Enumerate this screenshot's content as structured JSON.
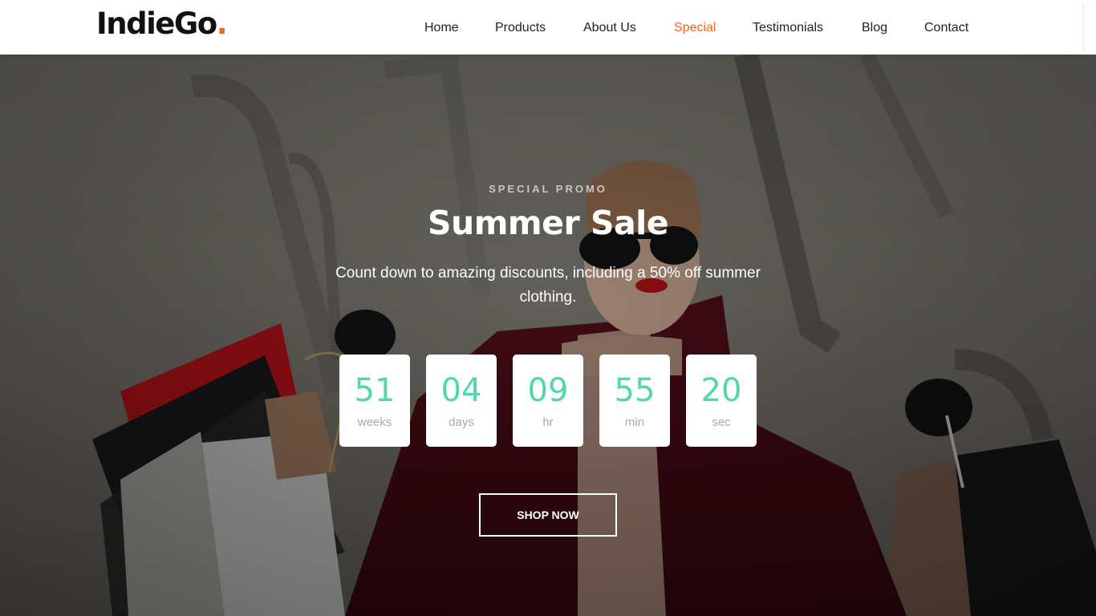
{
  "header": {
    "logo_text": "IndieGo",
    "logo_dot": ".",
    "nav": [
      {
        "label": "Home"
      },
      {
        "label": "Products"
      },
      {
        "label": "About Us"
      },
      {
        "label": "Special",
        "active": true
      },
      {
        "label": "Testimonials"
      },
      {
        "label": "Blog"
      },
      {
        "label": "Contact"
      }
    ]
  },
  "hero": {
    "eyebrow": "SPECIAL PROMO",
    "title": "Summer Sale",
    "subtitle": "Count down to amazing discounts, including a 50% off summer clothing.",
    "countdown": [
      {
        "value": "51",
        "unit": "weeks"
      },
      {
        "value": "04",
        "unit": "days"
      },
      {
        "value": "09",
        "unit": "hr"
      },
      {
        "value": "55",
        "unit": "min"
      },
      {
        "value": "20",
        "unit": "sec"
      }
    ],
    "cta_label": "SHOP NOW"
  },
  "colors": {
    "accent": "#f26522",
    "countdown_number": "#4fd8a8",
    "text_dark": "#222222"
  }
}
